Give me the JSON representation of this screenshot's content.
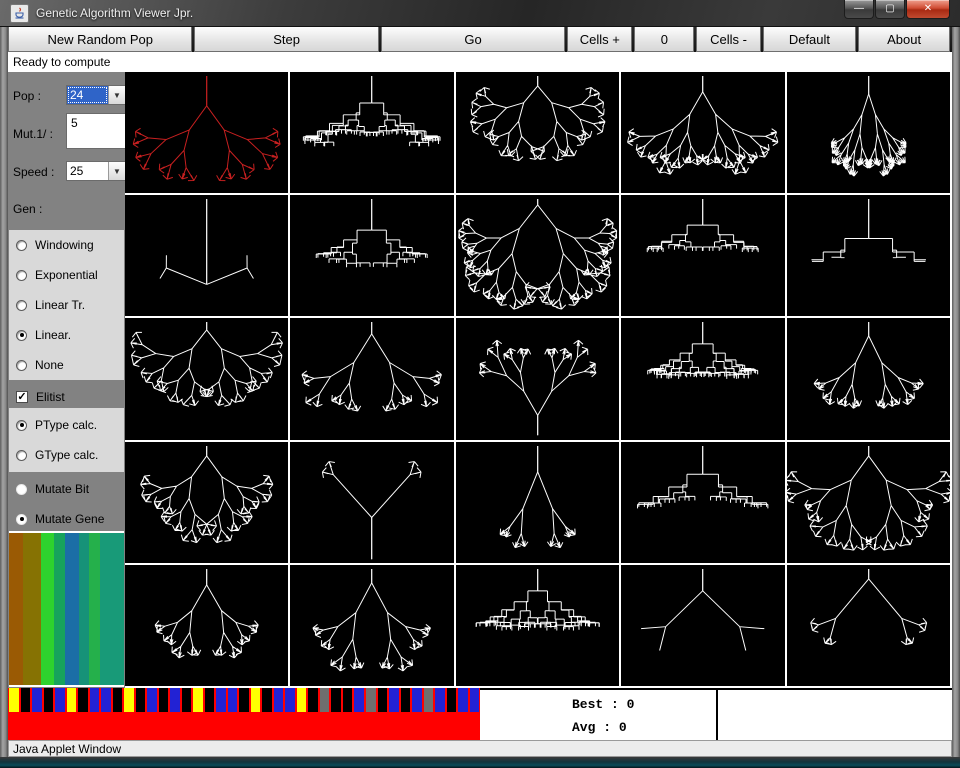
{
  "window": {
    "title": "Genetic Algorithm Viewer Jpr.",
    "controls": [
      {
        "name": "minimize",
        "glyph": "—"
      },
      {
        "name": "maximize",
        "glyph": "▢"
      },
      {
        "name": "close",
        "glyph": "✕"
      }
    ]
  },
  "toolbar": {
    "buttons": [
      {
        "label": "New Random Pop",
        "interactable": true
      },
      {
        "label": "Step",
        "interactable": true
      },
      {
        "label": "Go",
        "interactable": true
      },
      {
        "label": "Cells +",
        "interactable": true
      },
      {
        "label": "0",
        "interactable": false
      },
      {
        "label": "Cells -",
        "interactable": true
      },
      {
        "label": "Default",
        "interactable": true
      },
      {
        "label": "About",
        "interactable": true
      }
    ]
  },
  "status_line": "Ready to compute",
  "sidebar": {
    "pop": {
      "label": "Pop :",
      "value": "24",
      "selected": true
    },
    "mut": {
      "label": "Mut.1/ :",
      "value": "5"
    },
    "speed": {
      "label": "Speed :",
      "value": "25",
      "selected": false
    },
    "gen": {
      "label": "Gen :"
    },
    "selection_group": [
      {
        "label": "Windowing",
        "selected": false
      },
      {
        "label": "Exponential",
        "selected": false
      },
      {
        "label": "Linear Tr.",
        "selected": false
      },
      {
        "label": "Linear.",
        "selected": true
      },
      {
        "label": "None",
        "selected": false
      }
    ],
    "elitist": {
      "label": "Elitist",
      "checked": true
    },
    "type_group": [
      {
        "label": "PType calc.",
        "selected": true
      },
      {
        "label": "GType calc.",
        "selected": false
      }
    ],
    "mutate_group": [
      {
        "label": "Mutate Bit",
        "selected": false
      },
      {
        "label": "Mutate Gene",
        "selected": true
      }
    ],
    "gradient_stripes": [
      {
        "color": "#9a5a04",
        "w": 14
      },
      {
        "color": "#867203",
        "w": 19
      },
      {
        "color": "#2ed22e",
        "w": 13
      },
      {
        "color": "#17a35c",
        "w": 11
      },
      {
        "color": "#1b6ea6",
        "w": 14
      },
      {
        "color": "#169278",
        "w": 10
      },
      {
        "color": "#25b04b",
        "w": 12
      },
      {
        "color": "#189a78",
        "w": 24
      }
    ]
  },
  "grid": {
    "rows": 5,
    "cols": 5,
    "tree_color_default": "#ffffff",
    "cells": [
      {
        "style": "diag",
        "origin": "top",
        "trunk": 30,
        "len": 30,
        "spread": 36,
        "decay": 0.78,
        "depth": 4,
        "tip": "arrow",
        "color": "#c82020",
        "seed": 11
      },
      {
        "style": "ortho",
        "origin": "top",
        "trunk": 14,
        "len": 24,
        "spread": 34,
        "decay": 0.82,
        "depth": 5,
        "tip": "tbar",
        "color": "#ffffff",
        "seed": 2
      },
      {
        "style": "diag",
        "origin": "top",
        "trunk": 10,
        "len": 22,
        "spread": 40,
        "decay": 0.84,
        "depth": 5,
        "tip": "arrow",
        "color": "#ffffff",
        "seed": 3
      },
      {
        "style": "diag",
        "origin": "top",
        "trunk": 16,
        "len": 26,
        "spread": 30,
        "decay": 0.8,
        "depth": 5,
        "tip": "arrow",
        "color": "#ffffff",
        "seed": 4
      },
      {
        "style": "diag",
        "origin": "top",
        "trunk": 18,
        "len": 22,
        "spread": 18,
        "decay": 0.82,
        "depth": 5,
        "tip": "arrow",
        "color": "#ffffff",
        "seed": 5
      },
      {
        "style": "diag",
        "origin": "top",
        "trunk": 86,
        "len": 44,
        "spread": 112,
        "decay": 0.3,
        "depth": 2,
        "tip": "none",
        "color": "#ffffff",
        "seed": 6
      },
      {
        "style": "ortho",
        "origin": "top",
        "trunk": 16,
        "len": 28,
        "spread": 36,
        "decay": 0.75,
        "depth": 4,
        "tip": "tbar",
        "color": "#ffffff",
        "seed": 7
      },
      {
        "style": "diag",
        "origin": "top",
        "trunk": 6,
        "len": 30,
        "spread": 38,
        "decay": 0.8,
        "depth": 6,
        "tip": "arrow",
        "color": "#ffffff",
        "seed": 8
      },
      {
        "style": "ortho",
        "origin": "top",
        "trunk": 12,
        "len": 26,
        "spread": 42,
        "decay": 0.76,
        "depth": 4,
        "tip": "tbar",
        "color": "#ffffff",
        "seed": 9
      },
      {
        "style": "ortho",
        "origin": "top",
        "trunk": 20,
        "len": 36,
        "spread": 48,
        "decay": 0.6,
        "depth": 3,
        "tip": "none",
        "color": "#ffffff",
        "seed": 10
      },
      {
        "style": "diag",
        "origin": "top",
        "trunk": 8,
        "len": 24,
        "spread": 38,
        "decay": 0.82,
        "depth": 5,
        "tip": "arrow",
        "color": "#ffffff",
        "seed": 1
      },
      {
        "style": "diag",
        "origin": "top",
        "trunk": 12,
        "len": 34,
        "spread": 32,
        "decay": 0.72,
        "depth": 4,
        "tip": "arrow",
        "color": "#ffffff",
        "seed": 12
      },
      {
        "style": "diag",
        "origin": "bottom",
        "trunk": 20,
        "len": 28,
        "spread": 30,
        "decay": 0.76,
        "depth": 4,
        "tip": "arrow",
        "color": "#ffffff",
        "seed": 13
      },
      {
        "style": "ortho",
        "origin": "top",
        "trunk": 10,
        "len": 22,
        "spread": 32,
        "decay": 0.82,
        "depth": 5,
        "tip": "tbar",
        "color": "#ffffff",
        "seed": 14
      },
      {
        "style": "diag",
        "origin": "top",
        "trunk": 14,
        "len": 30,
        "spread": 26,
        "decay": 0.72,
        "depth": 4,
        "tip": "arrow",
        "color": "#ffffff",
        "seed": 15
      },
      {
        "style": "diag",
        "origin": "top",
        "trunk": 10,
        "len": 26,
        "spread": 36,
        "decay": 0.8,
        "depth": 5,
        "tip": "arrow",
        "color": "#ffffff",
        "seed": 16
      },
      {
        "style": "diag",
        "origin": "bottom",
        "trunk": 42,
        "len": 58,
        "spread": 42,
        "decay": 0.22,
        "depth": 2,
        "tip": "arrow",
        "color": "#ffffff",
        "seed": 17
      },
      {
        "style": "diag",
        "origin": "top",
        "trunk": 26,
        "len": 40,
        "spread": 22,
        "decay": 0.55,
        "depth": 3,
        "tip": "arrow",
        "color": "#ffffff",
        "seed": 18
      },
      {
        "style": "ortho",
        "origin": "top",
        "trunk": 12,
        "len": 30,
        "spread": 36,
        "decay": 0.72,
        "depth": 4,
        "tip": "tbar",
        "color": "#ffffff",
        "seed": 19
      },
      {
        "style": "diag",
        "origin": "top",
        "trunk": 10,
        "len": 30,
        "spread": 36,
        "decay": 0.76,
        "depth": 5,
        "tip": "arrow",
        "color": "#ffffff",
        "seed": 20
      },
      {
        "style": "diag",
        "origin": "top",
        "trunk": 16,
        "len": 30,
        "spread": 30,
        "decay": 0.72,
        "depth": 4,
        "tip": "arrow",
        "color": "#ffffff",
        "seed": 21
      },
      {
        "style": "diag",
        "origin": "top",
        "trunk": 14,
        "len": 34,
        "spread": 28,
        "decay": 0.7,
        "depth": 4,
        "tip": "arrow",
        "color": "#ffffff",
        "seed": 22
      },
      {
        "style": "ortho",
        "origin": "top",
        "trunk": 10,
        "len": 22,
        "spread": 30,
        "decay": 0.82,
        "depth": 5,
        "tip": "tbar",
        "color": "#ffffff",
        "seed": 23
      },
      {
        "style": "diag",
        "origin": "top",
        "trunk": 22,
        "len": 52,
        "spread": 46,
        "decay": 0.45,
        "depth": 2,
        "tip": "none",
        "color": "#ffffff",
        "seed": 24
      },
      {
        "style": "diag",
        "origin": "top",
        "trunk": 10,
        "len": 52,
        "spread": 40,
        "decay": 0.4,
        "depth": 3,
        "tip": "arrow",
        "color": "#ffffff",
        "seed": 25
      }
    ]
  },
  "bottom": {
    "barcode": {
      "background": "#ff0000",
      "blocks": [
        "#ffff00",
        "#000000",
        "#2222d4",
        "#000000",
        "#2222d4",
        "#ffff00",
        "#000000",
        "#2222d4",
        "#2222d4",
        "#000000",
        "#ffff00",
        "#000000",
        "#2222d4",
        "#000000",
        "#2222d4",
        "#000000",
        "#ffff00",
        "#000000",
        "#2222d4",
        "#2222d4",
        "#000000",
        "#ffff00",
        "#000000",
        "#2222d4",
        "#2222d4",
        "#ffff00",
        "#000000",
        "#6e6e6e",
        "#000000",
        "#000000",
        "#2222d4",
        "#6e6e6e",
        "#000000",
        "#2222d4",
        "#000000",
        "#2222d4",
        "#6e6e6e",
        "#2222d4",
        "#000000",
        "#2222d4",
        "#2222d4"
      ]
    },
    "stats": {
      "best_label": "Best :",
      "best_value": "0",
      "avg_label": "Avg  :",
      "avg_value": "0"
    }
  },
  "statusbar": "Java Applet Window"
}
